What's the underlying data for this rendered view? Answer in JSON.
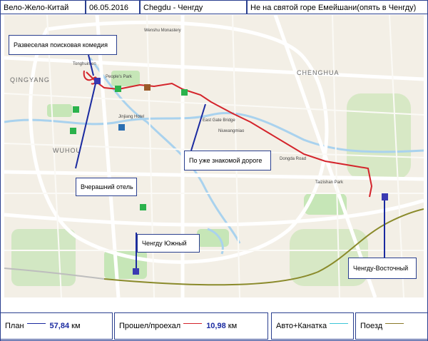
{
  "header": {
    "title": "Вело-Жело-Китай",
    "date": "06.05.2016",
    "route": "Chegdu - Ченгду",
    "note": "Не на святой горе Емейшани(опять в Ченгду)"
  },
  "map": {
    "district_labels": [
      "QINGYANG",
      "WUHOU",
      "CHENGHUA"
    ],
    "place_labels": [
      "Tonghuimen",
      "People's Park",
      "Jinjiang Hotel",
      "East Gate Bridge",
      "Niuwangmiao",
      "Dongda Road",
      "Taizishan Park",
      "Wenshu Monastery"
    ],
    "callouts": {
      "comedy": "Развеселая поисковая комедия",
      "hotel": "Вчерашний отель",
      "familiar_road": "По уже знакомой дороге",
      "south_station": "Ченгду Южный",
      "east_station": "Ченгду-Восточный"
    },
    "colors": {
      "background": "#f3efe6",
      "water": "#a9d2ee",
      "park": "#c6e6b7",
      "road": "#ffffff",
      "route_plan": "#1a2aa0",
      "route_done": "#d4242b",
      "railway": "#8a8a2a",
      "marker": "#2bb24c"
    }
  },
  "footer": {
    "plan_label": "План",
    "plan_value": "57,84",
    "plan_unit": "км",
    "plan_color": "#1a2aa0",
    "done_label": "Прошел/проехал",
    "done_value": "10,98",
    "done_unit": "км",
    "done_color": "#d4242b",
    "auto_label": "Авто+Канатка",
    "auto_color": "#3cc6d8",
    "train_label": "Поезд",
    "train_color": "#8a7a2a"
  }
}
